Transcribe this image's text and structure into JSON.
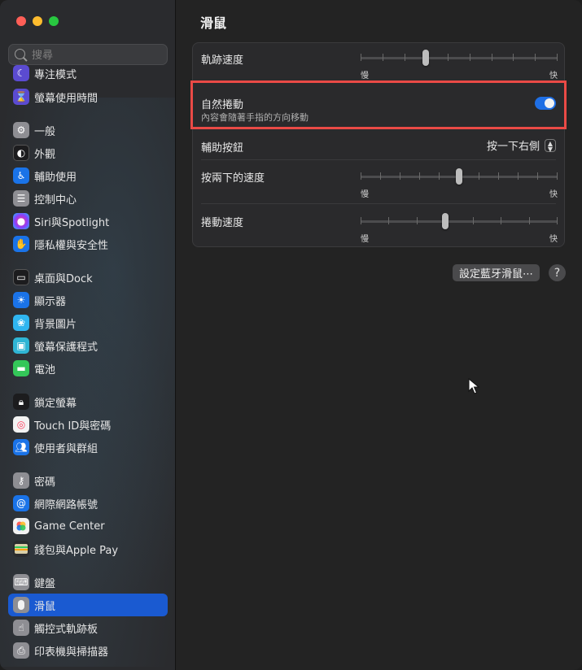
{
  "window": {
    "title": "滑鼠"
  },
  "search": {
    "placeholder": "搜尋"
  },
  "sidebar": {
    "items": [
      {
        "label": "專注模式",
        "icon": "moon-icon",
        "color": "#5b4bd1"
      },
      {
        "label": "螢幕使用時間",
        "icon": "hourglass-icon",
        "color": "#5b4bd1"
      },
      {
        "label": "一般",
        "icon": "gear-icon",
        "color": "#8e8e93"
      },
      {
        "label": "外觀",
        "icon": "appearance-icon",
        "color": "#1c1c1e"
      },
      {
        "label": "輔助使用",
        "icon": "accessibility-icon",
        "color": "#1a73e8"
      },
      {
        "label": "控制中心",
        "icon": "control-center-icon",
        "color": "#8e8e93"
      },
      {
        "label": "Siri與Spotlight",
        "icon": "siri-icon",
        "color": "#8a3ffc"
      },
      {
        "label": "隱私權與安全性",
        "icon": "hand-icon",
        "color": "#1a73e8"
      },
      {
        "label": "桌面與Dock",
        "icon": "dock-icon",
        "color": "#1c1c1e"
      },
      {
        "label": "顯示器",
        "icon": "sun-icon",
        "color": "#1a73e8"
      },
      {
        "label": "背景圖片",
        "icon": "flower-icon",
        "color": "#2fb5f0"
      },
      {
        "label": "螢幕保護程式",
        "icon": "screensaver-icon",
        "color": "#2fb5d4"
      },
      {
        "label": "電池",
        "icon": "battery-icon",
        "color": "#34c759"
      },
      {
        "label": "鎖定螢幕",
        "icon": "lock-icon",
        "color": "#1c1c1e"
      },
      {
        "label": "Touch ID與密碼",
        "icon": "fingerprint-icon",
        "color": "#f2f2f2"
      },
      {
        "label": "使用者與群組",
        "icon": "users-icon",
        "color": "#1a73e8"
      },
      {
        "label": "密碼",
        "icon": "key-icon",
        "color": "#8e8e93"
      },
      {
        "label": "網際網路帳號",
        "icon": "at-icon",
        "color": "#1a73e8"
      },
      {
        "label": "Game Center",
        "icon": "game-center-icon",
        "color": "#f2f2f2"
      },
      {
        "label": "錢包與Apple Pay",
        "icon": "wallet-icon",
        "color": "#2a2b2e"
      },
      {
        "label": "鍵盤",
        "icon": "keyboard-icon",
        "color": "#8e8e93"
      },
      {
        "label": "滑鼠",
        "icon": "mouse-icon",
        "color": "#8e8e93"
      },
      {
        "label": "觸控式軌跡板",
        "icon": "trackpad-icon",
        "color": "#8e8e93"
      },
      {
        "label": "印表機與掃描器",
        "icon": "printer-icon",
        "color": "#8e8e93"
      }
    ],
    "active_label": "滑鼠"
  },
  "settings": {
    "tracking_speed": {
      "label": "軌跡速度",
      "min_label": "慢",
      "max_label": "快",
      "ticks": 10,
      "value": 0.33
    },
    "natural_scrolling": {
      "label": "自然捲動",
      "description": "內容會隨著手指的方向移動",
      "enabled": true
    },
    "secondary_click": {
      "label": "輔助按鈕",
      "value": "按一下右側"
    },
    "double_click_speed": {
      "label": "按兩下的速度",
      "min_label": "慢",
      "max_label": "快",
      "ticks": 11,
      "value": 0.5
    },
    "scroll_speed": {
      "label": "捲動速度",
      "min_label": "慢",
      "max_label": "快",
      "ticks": 8,
      "value": 0.43
    }
  },
  "actions": {
    "bluetooth_button": "設定藍牙滑鼠⋯",
    "help_button": "?"
  },
  "colors": {
    "accent": "#1a5ad1",
    "highlight": "#ea4a46",
    "toggle_on": "#1f6fe5"
  }
}
